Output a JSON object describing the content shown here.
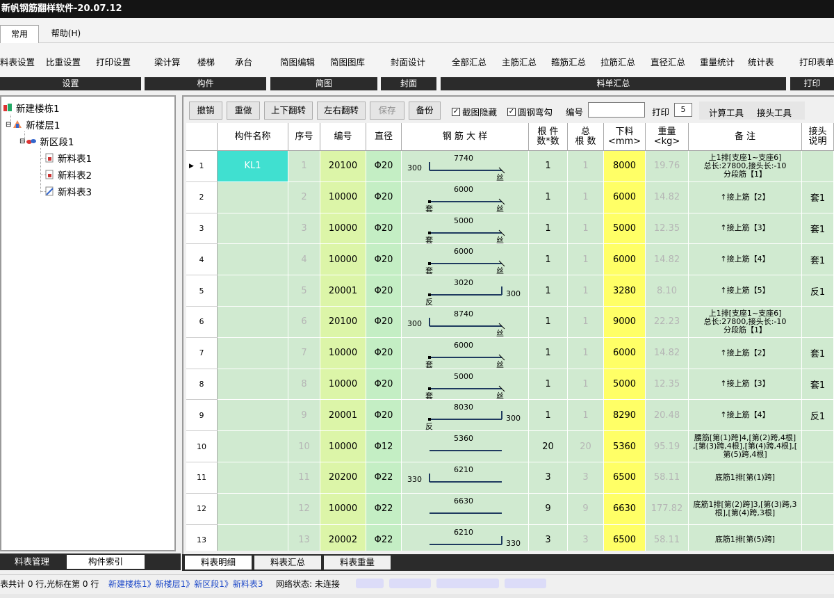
{
  "title": "新帆钢筋翻样软件-20.07.12",
  "menu": {
    "tab_common": "常用",
    "tab_help": "帮助(H)"
  },
  "ribbon": {
    "groups": [
      {
        "label": "设置",
        "buttons": [
          "料表设置",
          "比重设置",
          "打印设置"
        ]
      },
      {
        "label": "构件",
        "buttons": [
          "梁计算",
          "楼梯",
          "承台"
        ]
      },
      {
        "label": "简图",
        "buttons": [
          "简图编辑",
          "简图图库"
        ]
      },
      {
        "label": "封面",
        "buttons": [
          "封面设计"
        ]
      },
      {
        "label": "料单汇总",
        "buttons": [
          "全部汇总",
          "主筋汇总",
          "箍筋汇总",
          "拉筋汇总",
          "直径汇总",
          "重量统计",
          "统计表"
        ]
      },
      {
        "label": "打印",
        "buttons": [
          "打印表单"
        ]
      }
    ]
  },
  "tree": {
    "building": "新建楼栋1",
    "floor": "新楼层1",
    "section": "新区段1",
    "sheets": [
      "新料表1",
      "新料表2",
      "新料表3"
    ]
  },
  "left_tabs": [
    "料表管理",
    "构件索引"
  ],
  "toolbar": {
    "undo": "撤销",
    "redo": "重做",
    "flip_v": "上下翻转",
    "flip_h": "左右翻转",
    "save": "保存",
    "backup": "备份",
    "chk_hide": "截图隐藏",
    "chk_bend": "圆钢弯勾",
    "code_label": "编号",
    "code_value": "",
    "print_label": "打印",
    "print_value": "5",
    "calc_tool": "计算工具",
    "joint_tool": "接头工具"
  },
  "table": {
    "headers": {
      "name": "构件名称",
      "seq": "序号",
      "code": "编号",
      "dia": "直径",
      "shape": "钢 筋 大 样",
      "count": "根 件\n数*数",
      "total": "总\n根 数",
      "cut": "下料\n<mm>",
      "weight": "重量\n<kg>",
      "note": "备 注",
      "joint": "接头\n说明"
    },
    "rows": [
      {
        "n": "1",
        "name": "KL1",
        "seq": "1",
        "code": "20100",
        "dia": "Φ20",
        "count": "1",
        "total": "1",
        "cut": "8000",
        "weight": "19.76",
        "note": [
          "上1排[支座1~支座6]",
          "总长:27800,接头长:-10",
          "分段筋【1】"
        ],
        "joint": "",
        "shape": {
          "len": "7740",
          "left": "300",
          "right": "",
          "end": "丝",
          "start": ""
        }
      },
      {
        "n": "2",
        "name": "",
        "seq": "2",
        "code": "10000",
        "dia": "Φ20",
        "count": "1",
        "total": "1",
        "cut": "6000",
        "weight": "14.82",
        "note": [
          "↑接上筋【2】"
        ],
        "joint": "套1",
        "shape": {
          "len": "6000",
          "left": "",
          "right": "",
          "end": "丝",
          "start": "套"
        }
      },
      {
        "n": "3",
        "name": "",
        "seq": "3",
        "code": "10000",
        "dia": "Φ20",
        "count": "1",
        "total": "1",
        "cut": "5000",
        "weight": "12.35",
        "note": [
          "↑接上筋【3】"
        ],
        "joint": "套1",
        "shape": {
          "len": "5000",
          "left": "",
          "right": "",
          "end": "丝",
          "start": "套"
        }
      },
      {
        "n": "4",
        "name": "",
        "seq": "4",
        "code": "10000",
        "dia": "Φ20",
        "count": "1",
        "total": "1",
        "cut": "6000",
        "weight": "14.82",
        "note": [
          "↑接上筋【4】"
        ],
        "joint": "套1",
        "shape": {
          "len": "6000",
          "left": "",
          "right": "",
          "end": "丝",
          "start": "套"
        }
      },
      {
        "n": "5",
        "name": "",
        "seq": "5",
        "code": "20001",
        "dia": "Φ20",
        "count": "1",
        "total": "1",
        "cut": "3280",
        "weight": "8.10",
        "note": [
          "↑接上筋【5】"
        ],
        "joint": "反1",
        "shape": {
          "len": "3020",
          "left": "",
          "right": "300",
          "end": "",
          "start": "反"
        }
      },
      {
        "n": "6",
        "name": "",
        "seq": "6",
        "code": "20100",
        "dia": "Φ20",
        "count": "1",
        "total": "1",
        "cut": "9000",
        "weight": "22.23",
        "note": [
          "上1排[支座1~支座6]",
          "总长:27800,接头长:-10",
          "分段筋【1】"
        ],
        "joint": "",
        "shape": {
          "len": "8740",
          "left": "300",
          "right": "",
          "end": "丝",
          "start": ""
        }
      },
      {
        "n": "7",
        "name": "",
        "seq": "7",
        "code": "10000",
        "dia": "Φ20",
        "count": "1",
        "total": "1",
        "cut": "6000",
        "weight": "14.82",
        "note": [
          "↑接上筋【2】"
        ],
        "joint": "套1",
        "shape": {
          "len": "6000",
          "left": "",
          "right": "",
          "end": "丝",
          "start": "套"
        }
      },
      {
        "n": "8",
        "name": "",
        "seq": "8",
        "code": "10000",
        "dia": "Φ20",
        "count": "1",
        "total": "1",
        "cut": "5000",
        "weight": "12.35",
        "note": [
          "↑接上筋【3】"
        ],
        "joint": "套1",
        "shape": {
          "len": "5000",
          "left": "",
          "right": "",
          "end": "丝",
          "start": "套"
        }
      },
      {
        "n": "9",
        "name": "",
        "seq": "9",
        "code": "20001",
        "dia": "Φ20",
        "count": "1",
        "total": "1",
        "cut": "8290",
        "weight": "20.48",
        "note": [
          "↑接上筋【4】"
        ],
        "joint": "反1",
        "shape": {
          "len": "8030",
          "left": "",
          "right": "300",
          "end": "",
          "start": "反"
        }
      },
      {
        "n": "10",
        "name": "",
        "seq": "10",
        "code": "10000",
        "dia": "Φ12",
        "count": "20",
        "total": "20",
        "cut": "5360",
        "weight": "95.19",
        "note": [
          "腰筋[第(1)跨]4,[第(2)跨,4根]",
          ",[第(3)跨,4根],[第(4)跨,4根],[",
          "第(5)跨,4根]"
        ],
        "joint": "",
        "shape": {
          "len": "5360",
          "left": "",
          "right": "",
          "end": "",
          "start": ""
        }
      },
      {
        "n": "11",
        "name": "",
        "seq": "11",
        "code": "20200",
        "dia": "Φ22",
        "count": "3",
        "total": "3",
        "cut": "6500",
        "weight": "58.11",
        "note": [
          "底筋1排[第(1)跨]"
        ],
        "joint": "",
        "shape": {
          "len": "6210",
          "left": "330",
          "right": "",
          "end": "",
          "start": ""
        }
      },
      {
        "n": "12",
        "name": "",
        "seq": "12",
        "code": "10000",
        "dia": "Φ22",
        "count": "9",
        "total": "9",
        "cut": "6630",
        "weight": "177.82",
        "note": [
          "底筋1排[第(2)跨]3,[第(3)跨,3",
          "根],[第(4)跨,3根]"
        ],
        "joint": "",
        "shape": {
          "len": "6630",
          "left": "",
          "right": "",
          "end": "",
          "start": ""
        }
      },
      {
        "n": "13",
        "name": "",
        "seq": "13",
        "code": "20002",
        "dia": "Φ22",
        "count": "3",
        "total": "3",
        "cut": "6500",
        "weight": "58.11",
        "note": [
          "底筋1排[第(5)跨]"
        ],
        "joint": "",
        "shape": {
          "len": "6210",
          "left": "",
          "right": "330",
          "end": "",
          "start": ""
        }
      }
    ]
  },
  "bottom_tabs": [
    "料表明细",
    "料表汇总",
    "料表重量"
  ],
  "status": {
    "rows": "表共计 0 行,光标在第 0 行",
    "path": "新建楼栋1》新楼层1》新区段1》新料表3",
    "network": "网络状态: 未连接"
  }
}
